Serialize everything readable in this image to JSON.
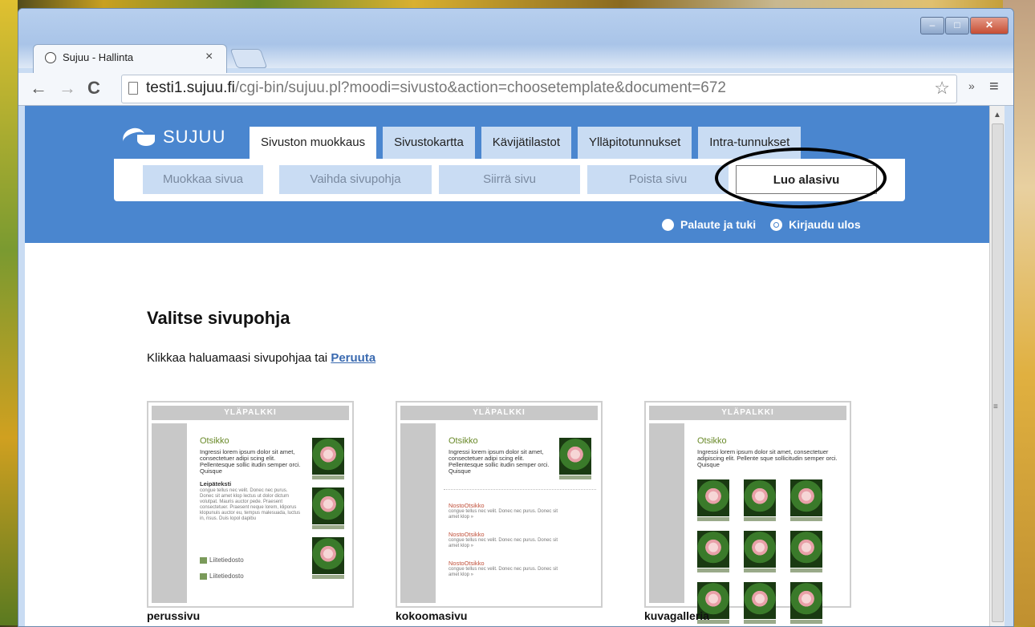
{
  "browser": {
    "tab_title": "Sujuu - Hallinta",
    "tab_close": "×",
    "url_host": "testi1.sujuu.fi",
    "url_path": "/cgi-bin/sujuu.pl?moodi=sivusto&action=choosetemplate&document=672",
    "window_controls": [
      "–",
      "□",
      "✕"
    ]
  },
  "site": {
    "logo_text": "SUJUU",
    "main_tabs": [
      "Sivuston muokkaus",
      "Sivustokartta",
      "Kävijätilastot",
      "Ylläpitotunnukset",
      "Intra-tunnukset"
    ],
    "sub_tabs": [
      "Muokkaa sivua",
      "Vaihda sivupohja",
      "Siirrä sivu",
      "Poista sivu",
      "Luo alasivu"
    ],
    "header_links": [
      "Palaute ja tuki",
      "Kirjaudu ulos"
    ]
  },
  "page": {
    "title": "Valitse sivupohja",
    "instruction": "Klikkaa haluamaasi sivupohjaa tai ",
    "cancel_link": "Peruuta"
  },
  "templates": {
    "bar_label": "YLÄPALKKI",
    "heading": "Otsikko",
    "lead_text": "Ingressi lorem ipsum dolor sit amet, consectetuer adipi scing elit. Pellentesque sollic itudin semper orci. Quisque",
    "lead_text_wide": "Ingressi lorem ipsum dolor sit amet, consectetuer adipiscing elit. Pellente sque sollicitudin semper orci. Quisque",
    "body_heading": "Leipäteksti",
    "body_text": "congue tellus nec velit. Donec nec purus. Donec sit amet klop lectus ut dolor dictum volutpat. Mauris auctor pede. Praesent consectetuer. Praesent neque lorem, kliporus klopunuis auctor eu, tempus malesuada, luctus in, risus. Duis lopol dapibu",
    "attachment": "Liitetiedosto",
    "nosto_title": "NostoOtsikko",
    "nosto_text": "congue tellus nec velit. Donec nec purus. Donec sit amet klop »",
    "names": [
      "perussivu",
      "kokoomasivu",
      "kuvagalleria"
    ]
  }
}
